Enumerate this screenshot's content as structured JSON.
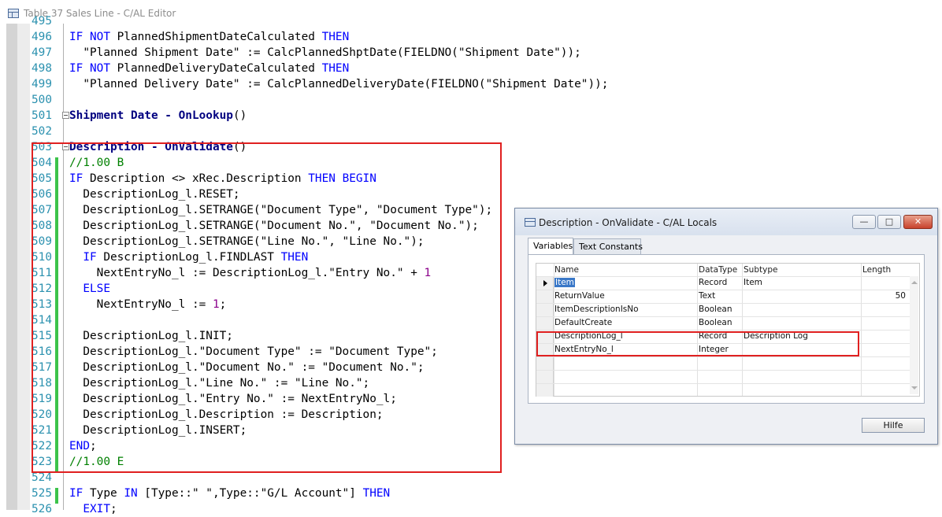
{
  "window": {
    "title": "Table 37 Sales Line - C/AL Editor"
  },
  "editor": {
    "lines": [
      {
        "num": "495",
        "tokens": []
      },
      {
        "num": "496",
        "tokens": [
          {
            "t": "kw",
            "s": "IF NOT"
          },
          {
            "t": "tx",
            "s": " PlannedShipmentDateCalculated "
          },
          {
            "t": "kw",
            "s": "THEN"
          }
        ]
      },
      {
        "num": "497",
        "tokens": [
          {
            "t": "tx",
            "s": "  \"Planned Shipment Date\" := CalcPlannedShptDate(FIELDNO(\"Shipment Date\"));"
          }
        ]
      },
      {
        "num": "498",
        "tokens": [
          {
            "t": "kw",
            "s": "IF NOT"
          },
          {
            "t": "tx",
            "s": " PlannedDeliveryDateCalculated "
          },
          {
            "t": "kw",
            "s": "THEN"
          }
        ]
      },
      {
        "num": "499",
        "tokens": [
          {
            "t": "tx",
            "s": "  \"Planned Delivery Date\" := CalcPlannedDeliveryDate(FIELDNO(\"Shipment Date\"));"
          }
        ]
      },
      {
        "num": "500",
        "tokens": []
      },
      {
        "num": "501",
        "fold": true,
        "tokens": [
          {
            "t": "tr",
            "s": "Shipment Date - OnLookup"
          },
          {
            "t": "tx",
            "s": "()"
          }
        ]
      },
      {
        "num": "502",
        "tokens": []
      },
      {
        "num": "503",
        "fold": true,
        "tokens": [
          {
            "t": "tr",
            "s": "Description - OnValidate"
          },
          {
            "t": "tx",
            "s": "()"
          }
        ]
      },
      {
        "num": "504",
        "tokens": [
          {
            "t": "cm",
            "s": "//1.00 B"
          }
        ]
      },
      {
        "num": "505",
        "tokens": [
          {
            "t": "kw",
            "s": "IF"
          },
          {
            "t": "tx",
            "s": " Description <> xRec.Description "
          },
          {
            "t": "kw",
            "s": "THEN BEGIN"
          }
        ]
      },
      {
        "num": "506",
        "tokens": [
          {
            "t": "tx",
            "s": "  DescriptionLog_l.RESET;"
          }
        ]
      },
      {
        "num": "507",
        "tokens": [
          {
            "t": "tx",
            "s": "  DescriptionLog_l.SETRANGE(\"Document Type\", \"Document Type\");"
          }
        ]
      },
      {
        "num": "508",
        "tokens": [
          {
            "t": "tx",
            "s": "  DescriptionLog_l.SETRANGE(\"Document No.\", \"Document No.\");"
          }
        ]
      },
      {
        "num": "509",
        "tokens": [
          {
            "t": "tx",
            "s": "  DescriptionLog_l.SETRANGE(\"Line No.\", \"Line No.\");"
          }
        ]
      },
      {
        "num": "510",
        "tokens": [
          {
            "t": "kw",
            "s": "  IF"
          },
          {
            "t": "tx",
            "s": " DescriptionLog_l.FINDLAST "
          },
          {
            "t": "kw",
            "s": "THEN"
          }
        ]
      },
      {
        "num": "511",
        "tokens": [
          {
            "t": "tx",
            "s": "    NextEntryNo_l := DescriptionLog_l.\"Entry No.\" + "
          },
          {
            "t": "num",
            "s": "1"
          }
        ]
      },
      {
        "num": "512",
        "tokens": [
          {
            "t": "kw",
            "s": "  ELSE"
          }
        ]
      },
      {
        "num": "513",
        "tokens": [
          {
            "t": "tx",
            "s": "    NextEntryNo_l := "
          },
          {
            "t": "num",
            "s": "1"
          },
          {
            "t": "tx",
            "s": ";"
          }
        ]
      },
      {
        "num": "514",
        "tokens": []
      },
      {
        "num": "515",
        "tokens": [
          {
            "t": "tx",
            "s": "  DescriptionLog_l.INIT;"
          }
        ]
      },
      {
        "num": "516",
        "tokens": [
          {
            "t": "tx",
            "s": "  DescriptionLog_l.\"Document Type\" := \"Document Type\";"
          }
        ]
      },
      {
        "num": "517",
        "tokens": [
          {
            "t": "tx",
            "s": "  DescriptionLog_l.\"Document No.\" := \"Document No.\";"
          }
        ]
      },
      {
        "num": "518",
        "tokens": [
          {
            "t": "tx",
            "s": "  DescriptionLog_l.\"Line No.\" := \"Line No.\";"
          }
        ]
      },
      {
        "num": "519",
        "tokens": [
          {
            "t": "tx",
            "s": "  DescriptionLog_l.\"Entry No.\" := NextEntryNo_l;"
          }
        ]
      },
      {
        "num": "520",
        "tokens": [
          {
            "t": "tx",
            "s": "  DescriptionLog_l.Description := Description;"
          }
        ]
      },
      {
        "num": "521",
        "tokens": [
          {
            "t": "tx",
            "s": "  DescriptionLog_l.INSERT;"
          }
        ]
      },
      {
        "num": "522",
        "tokens": [
          {
            "t": "kw",
            "s": "END"
          },
          {
            "t": "tx",
            "s": ";"
          }
        ]
      },
      {
        "num": "523",
        "tokens": [
          {
            "t": "cm",
            "s": "//1.00 E"
          }
        ]
      },
      {
        "num": "524",
        "tokens": []
      },
      {
        "num": "525",
        "tokens": [
          {
            "t": "kw",
            "s": "IF"
          },
          {
            "t": "tx",
            "s": " Type "
          },
          {
            "t": "kw",
            "s": "IN"
          },
          {
            "t": "tx",
            "s": " [Type::\" \",Type::\"G/L Account\"] "
          },
          {
            "t": "kw",
            "s": "THEN"
          }
        ]
      },
      {
        "num": "526",
        "tokens": [
          {
            "t": "kw",
            "s": "  EXIT"
          },
          {
            "t": "tx",
            "s": ";"
          }
        ]
      }
    ]
  },
  "locals_dialog": {
    "title": "Description - OnValidate - C/AL Locals",
    "tabs": [
      "Variables",
      "Text Constants"
    ],
    "columns": [
      "Name",
      "DataType",
      "Subtype",
      "Length"
    ],
    "rows": [
      {
        "name": "Item",
        "datatype": "Record",
        "subtype": "Item",
        "length": ""
      },
      {
        "name": "ReturnValue",
        "datatype": "Text",
        "subtype": "",
        "length": "50"
      },
      {
        "name": "ItemDescriptionIsNo",
        "datatype": "Boolean",
        "subtype": "",
        "length": ""
      },
      {
        "name": "DefaultCreate",
        "datatype": "Boolean",
        "subtype": "",
        "length": ""
      },
      {
        "name": "DescriptionLog_l",
        "datatype": "Record",
        "subtype": "Description Log",
        "length": ""
      },
      {
        "name": "NextEntryNo_l",
        "datatype": "Integer",
        "subtype": "",
        "length": ""
      },
      {
        "name": "",
        "datatype": "",
        "subtype": "",
        "length": ""
      },
      {
        "name": "",
        "datatype": "",
        "subtype": "",
        "length": ""
      },
      {
        "name": "",
        "datatype": "",
        "subtype": "",
        "length": ""
      }
    ],
    "help_label": "Hilfe",
    "min_glyph": "—",
    "max_glyph": "□",
    "close_glyph": "✕"
  }
}
